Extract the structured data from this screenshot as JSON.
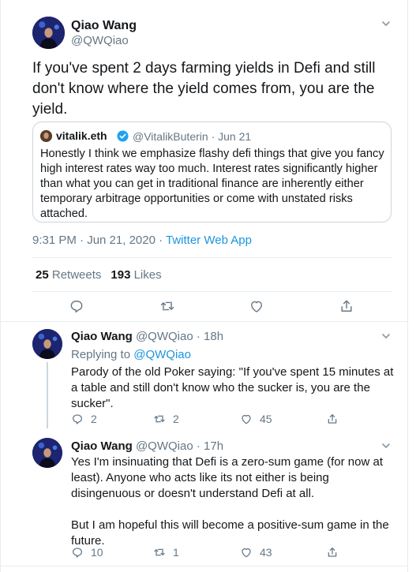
{
  "main_tweet": {
    "author_name": "Qiao Wang",
    "author_handle": "@QWQiao",
    "text": "If you've spent 2 days farming yields in Defi and still don't know where the yield comes from, you are the yield.",
    "quoted": {
      "author_name": "vitalik.eth",
      "author_handle": "@VitalikButerin",
      "separator": "·",
      "date": "Jun 21",
      "text": "Honestly I think we emphasize flashy defi things that give you fancy high interest rates way too much. Interest rates significantly higher than what you can get in traditional finance are inherently either temporary arbitrage opportunities or come with unstated risks attached."
    },
    "timestamp": "9:31 PM · Jun 21, 2020 · ",
    "source_app": "Twitter Web App",
    "retweets_count": "25",
    "retweets_label": "Retweets",
    "likes_count": "193",
    "likes_label": "Likes"
  },
  "replies": [
    {
      "author_name": "Qiao Wang",
      "author_handle": "@QWQiao",
      "time": "· 18h",
      "replying_to_label": "Replying to",
      "replying_to_handle": "@QWQiao",
      "paragraphs": [
        "Parody of the old Poker saying: \"If you've spent 15 minutes at a table and still don't know who the sucker is, you are the sucker\"."
      ],
      "reply_count": "2",
      "retweet_count": "2",
      "like_count": "45"
    },
    {
      "author_name": "Qiao Wang",
      "author_handle": "@QWQiao",
      "time": "· 17h",
      "paragraphs": [
        "Yes I'm insinuating that Defi is a zero-sum game (for now at least). Anyone who acts like its not either is being disingenuous or doesn't understand Defi at all.",
        "But I am hopeful this will become a positive-sum game in the future."
      ],
      "reply_count": "10",
      "retweet_count": "1",
      "like_count": "43"
    }
  ],
  "colors": {
    "link": "#1b95e0",
    "secondary_text": "#657786",
    "border": "#e6ecf0",
    "verified": "#1da1f2"
  },
  "icons": [
    "chevron-down-icon",
    "reply-icon",
    "retweet-icon",
    "like-icon",
    "share-icon",
    "verified-badge-icon"
  ]
}
